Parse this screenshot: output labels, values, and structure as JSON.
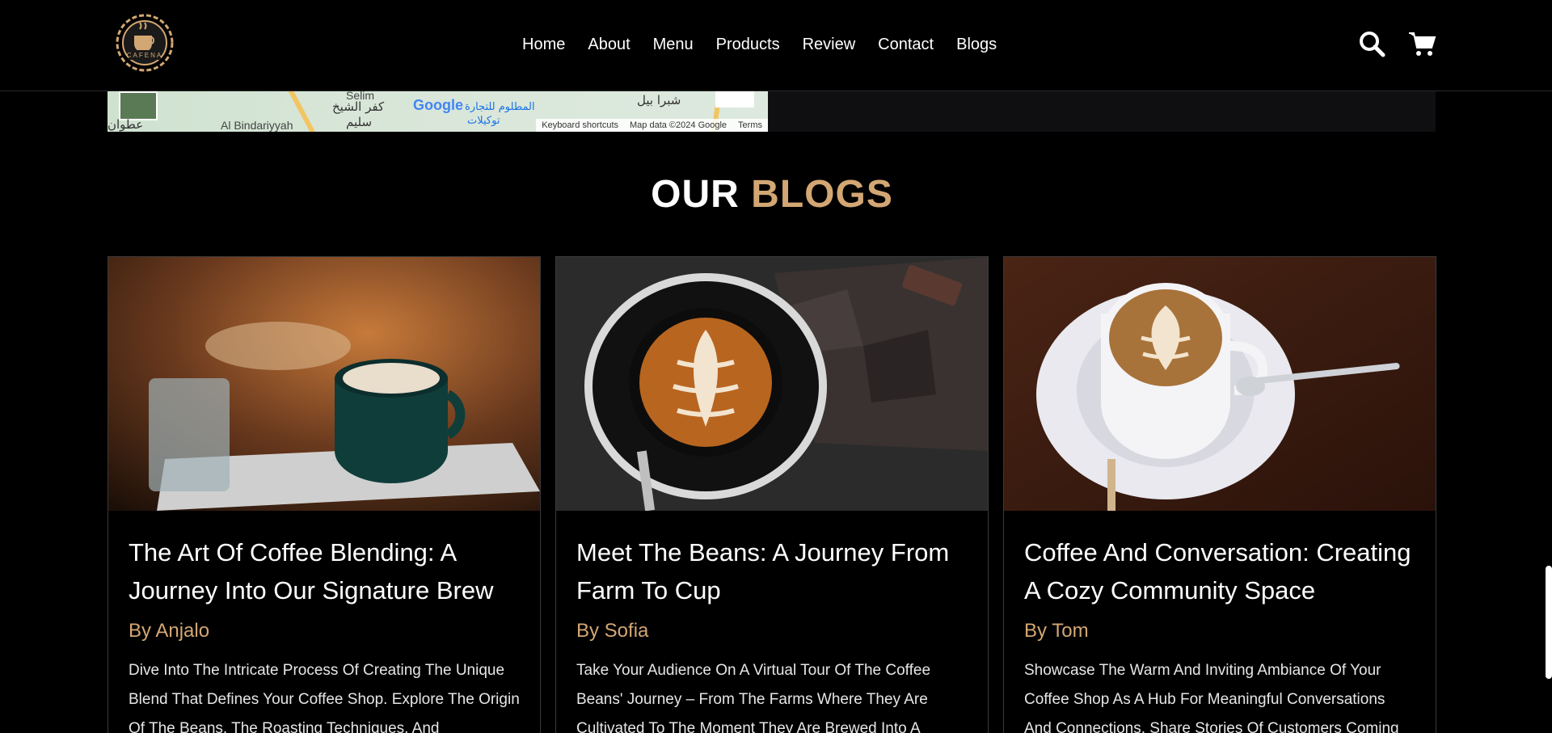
{
  "header": {
    "logo_text": "CAFENA",
    "nav": [
      "Home",
      "About",
      "Menu",
      "Products",
      "Review",
      "Contact",
      "Blogs"
    ]
  },
  "map": {
    "labels": {
      "selim": "Selim",
      "ar1": "كفر الشيخ",
      "ar2": "سليم",
      "ar3": "شبرا بيل",
      "ar4": "المطلوم للتجارة",
      "ar5": "توكيلات",
      "ar6": "عطوان",
      "bindariyyah": "Al Bindariyyah",
      "google": "Google"
    },
    "attribution": [
      "Keyboard shortcuts",
      "Map data ©2024 Google",
      "Terms"
    ]
  },
  "section": {
    "title_main": "OUR",
    "title_accent": "BLOGS"
  },
  "blogs": [
    {
      "title": "The Art Of Coffee Blending: A Journey Into Our Signature Brew",
      "author": "By Anjalo",
      "excerpt": "Dive Into The Intricate Process Of Creating The Unique Blend That Defines Your Coffee Shop. Explore The Origin Of The Beans, The Roasting Techniques, And"
    },
    {
      "title": "Meet The Beans: A Journey From Farm To Cup",
      "author": "By Sofia",
      "excerpt": "Take Your Audience On A Virtual Tour Of The Coffee Beans' Journey – From The Farms Where They Are Cultivated To The Moment They Are Brewed Into A"
    },
    {
      "title": "Coffee And Conversation: Creating A Cozy Community Space",
      "author": "By Tom",
      "excerpt": "Showcase The Warm And Inviting Ambiance Of Your Coffee Shop As A Hub For Meaningful Conversations And Connections. Share Stories Of Customers Coming"
    }
  ],
  "colors": {
    "accent": "#d3a774",
    "background": "#000000"
  }
}
